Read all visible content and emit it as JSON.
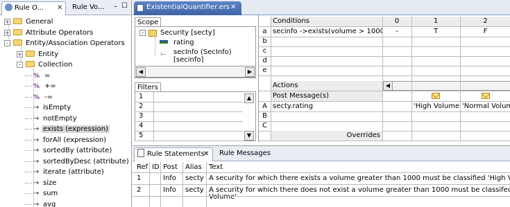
{
  "left_pane": {
    "tabs": [
      {
        "label": "Rule O...",
        "close": "✕"
      },
      {
        "label": "Rule Vo..."
      }
    ],
    "window_controls": {
      "minimize": "–",
      "maximize": "☐"
    },
    "tree": [
      {
        "label": "General",
        "expander": "+",
        "kind": "folder"
      },
      {
        "label": "Attribute Operators",
        "expander": "+",
        "kind": "folder"
      },
      {
        "label": "Entity/Association Operators",
        "expander": "–",
        "kind": "folder"
      },
      {
        "label": "Entity",
        "expander": "+",
        "kind": "folder"
      },
      {
        "label": "Collection",
        "expander": "–",
        "kind": "folder"
      },
      {
        "label": "=",
        "kind": "op"
      },
      {
        "label": "+=",
        "kind": "op"
      },
      {
        "label": "-=",
        "kind": "op"
      },
      {
        "label": "isEmpty",
        "kind": "arrow"
      },
      {
        "label": "notEmpty",
        "kind": "arrow"
      },
      {
        "label": "exists (expression)",
        "kind": "arrow",
        "selected": true
      },
      {
        "label": "forAll (expression)",
        "kind": "arrow"
      },
      {
        "label": "sortedBy (attribute)",
        "kind": "arrow"
      },
      {
        "label": "sortedByDesc (attribute)",
        "kind": "arrow"
      },
      {
        "label": "iterate (attribute)",
        "kind": "arrow"
      },
      {
        "label": "size",
        "kind": "arrow"
      },
      {
        "label": "sum",
        "kind": "arrow"
      },
      {
        "label": "avg",
        "kind": "arrow"
      }
    ],
    "op_glyph": "%",
    "arrow_glyph": "→"
  },
  "editor": {
    "tab_title": "ExistentialQuantifier.ers",
    "tab_close": "✕",
    "scope": {
      "label": "Scope",
      "root": "Security [secty]",
      "children": [
        "rating",
        "secInfo (SecInfo) [secinfo]"
      ]
    },
    "filters": {
      "label": "Filters",
      "rows": [
        "1",
        "2",
        "3",
        "4",
        "5"
      ]
    },
    "conditions": {
      "header": "Conditions",
      "row_letters": [
        "a",
        "b",
        "c",
        "d",
        "e"
      ],
      "rows": [
        "secinfo ->exists(volume > 1000)",
        "",
        "",
        "",
        ""
      ],
      "columns": [
        "0",
        "1",
        "2"
      ],
      "values": [
        [
          "-",
          "T",
          "F"
        ]
      ]
    },
    "actions": {
      "header": "Actions",
      "subheader": "Post Message(s)",
      "row_letters": [
        "A",
        "B",
        "C"
      ],
      "rows": [
        "secty.rating",
        "",
        ""
      ],
      "values": [
        "",
        "'High Volume'",
        "'Normal Volume'"
      ],
      "overrides": "Overrides"
    },
    "scroll": {
      "left": "◀",
      "right": "▶",
      "up": "▲",
      "down": "▼"
    }
  },
  "bottom": {
    "tabs": [
      {
        "label": "Rule Statements",
        "close": "✕"
      },
      {
        "label": "Rule Messages"
      }
    ],
    "columns": [
      "Ref",
      "ID",
      "Post",
      "Alias",
      "Text"
    ],
    "rows": [
      {
        "ref": "1",
        "id": "",
        "post": "Info",
        "alias": "secty",
        "text": "A security for which there exists a volume greater than 1000 must be classified 'High Volume'"
      },
      {
        "ref": "2",
        "id": "",
        "post": "Info",
        "alias": "secty",
        "text": "A security for which there does not exist a volume greater than 1000 must be classifed 'Normal",
        "text2": "Volume'"
      }
    ]
  }
}
